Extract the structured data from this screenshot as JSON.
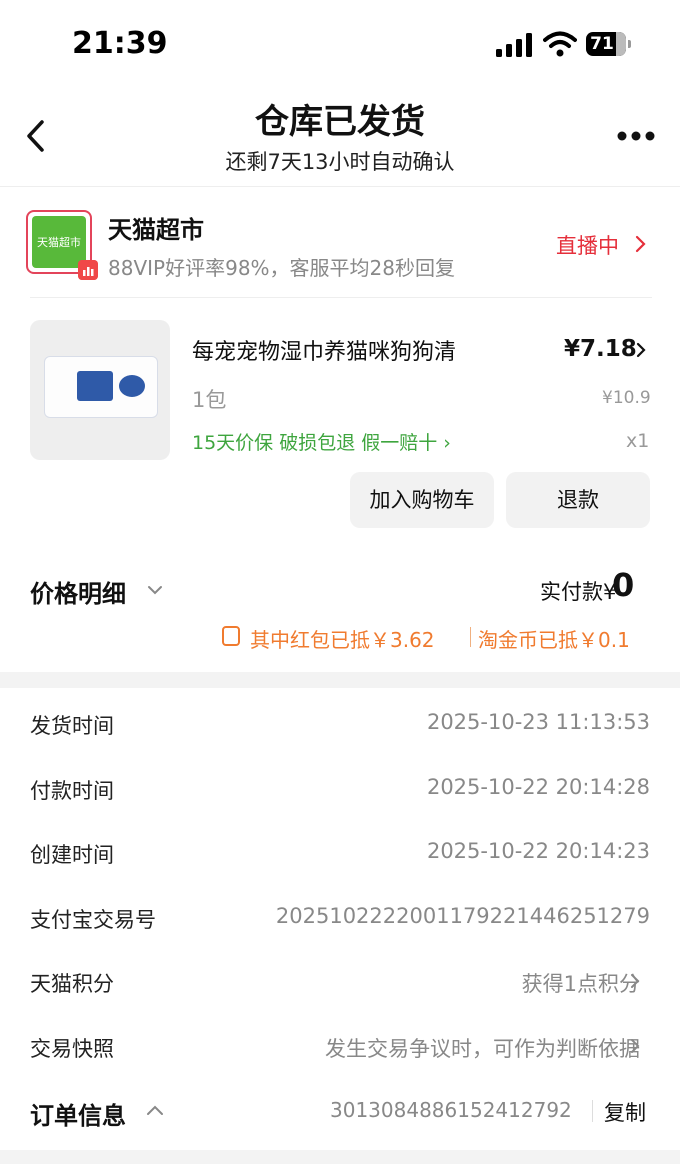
{
  "status_bar": {
    "time": "21:39",
    "battery": "71"
  },
  "header": {
    "title": "仓库已发货",
    "subtitle": "还剩7天13小时自动确认"
  },
  "shop": {
    "logo_text": "天猫超市",
    "name": "天猫超市",
    "desc": "88VIP好评率98%，客服平均28秒回复",
    "live": "直播中"
  },
  "product": {
    "name": "每宠宠物湿巾养猫咪狗狗清",
    "price": "¥7.18",
    "spec": "1包",
    "original_price": "¥10.9",
    "guarantees": "15天价保  破损包退  假一赔十 ›",
    "qty": "x1",
    "buttons": {
      "cart": "加入购物车",
      "refund": "退款"
    }
  },
  "price_detail": {
    "label": "价格明细",
    "paid_label": "实付款¥",
    "paid_value": "0",
    "promo1": "其中红包已抵￥3.62",
    "promo2": "淘金币已抵￥0.1"
  },
  "info": [
    {
      "label": "发货时间",
      "value": "2025-10-23 11:13:53",
      "chevron": false
    },
    {
      "label": "付款时间",
      "value": "2025-10-22 20:14:28",
      "chevron": false
    },
    {
      "label": "创建时间",
      "value": "2025-10-22 20:14:23",
      "chevron": false
    },
    {
      "label": "支付宝交易号",
      "value": "2025102222001179221446251279",
      "chevron": false
    },
    {
      "label": "天猫积分",
      "value": "获得1点积分",
      "chevron": true
    },
    {
      "label": "交易快照",
      "value": "发生交易争议时，可作为判断依据",
      "chevron": true
    }
  ],
  "order_info": {
    "label": "订单信息",
    "number": "3013084886152412792",
    "copy": "复制"
  },
  "colors": {
    "accent_red": "#e52f3b",
    "green": "#3ea53e",
    "orange": "#f07b2f"
  }
}
